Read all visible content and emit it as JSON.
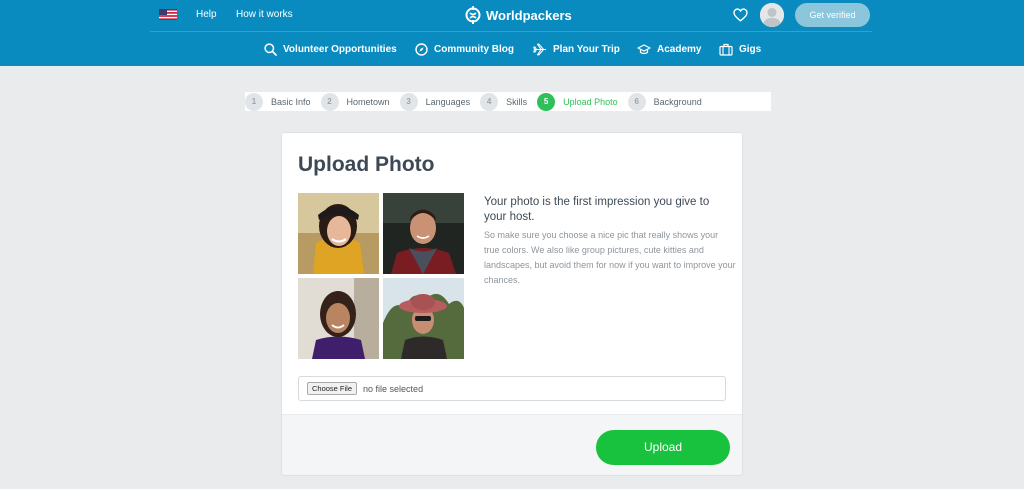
{
  "topbar": {
    "flag_icon": "us-flag-icon",
    "help_label": "Help",
    "how_it_works_label": "How it works",
    "brand": "Worldpackers",
    "heart_icon": "heart-icon",
    "verify_label": "Get verified"
  },
  "nav": {
    "items": [
      {
        "label": "Volunteer Opportunities",
        "icon": "search-icon"
      },
      {
        "label": "Community Blog",
        "icon": "compass-icon"
      },
      {
        "label": "Plan Your Trip",
        "icon": "airplane-icon"
      },
      {
        "label": "Academy",
        "icon": "graduation-cap-icon"
      },
      {
        "label": "Gigs",
        "icon": "briefcase-icon"
      }
    ]
  },
  "steps": {
    "items": [
      {
        "num": "1",
        "label": "Basic Info"
      },
      {
        "num": "2",
        "label": "Hometown"
      },
      {
        "num": "3",
        "label": "Languages"
      },
      {
        "num": "4",
        "label": "Skills"
      },
      {
        "num": "5",
        "label": "Upload Photo"
      },
      {
        "num": "6",
        "label": "Background"
      }
    ],
    "active_index": 4
  },
  "card": {
    "title": "Upload Photo",
    "intro_heading": "Your photo is the first impression you give to your host.",
    "intro_body": "So make sure you choose a nice pic that really shows your true colors. We also like group pictures, cute kitties and landscapes, but avoid them for now if you want to improve your chances.",
    "choose_file_label": "Choose File",
    "file_status": "no file selected",
    "upload_label": "Upload"
  },
  "colors": {
    "header_blue": "#0a8bc0",
    "active_green": "#2ec05a",
    "upload_green": "#19c23e",
    "page_bg": "#e9ebed"
  }
}
